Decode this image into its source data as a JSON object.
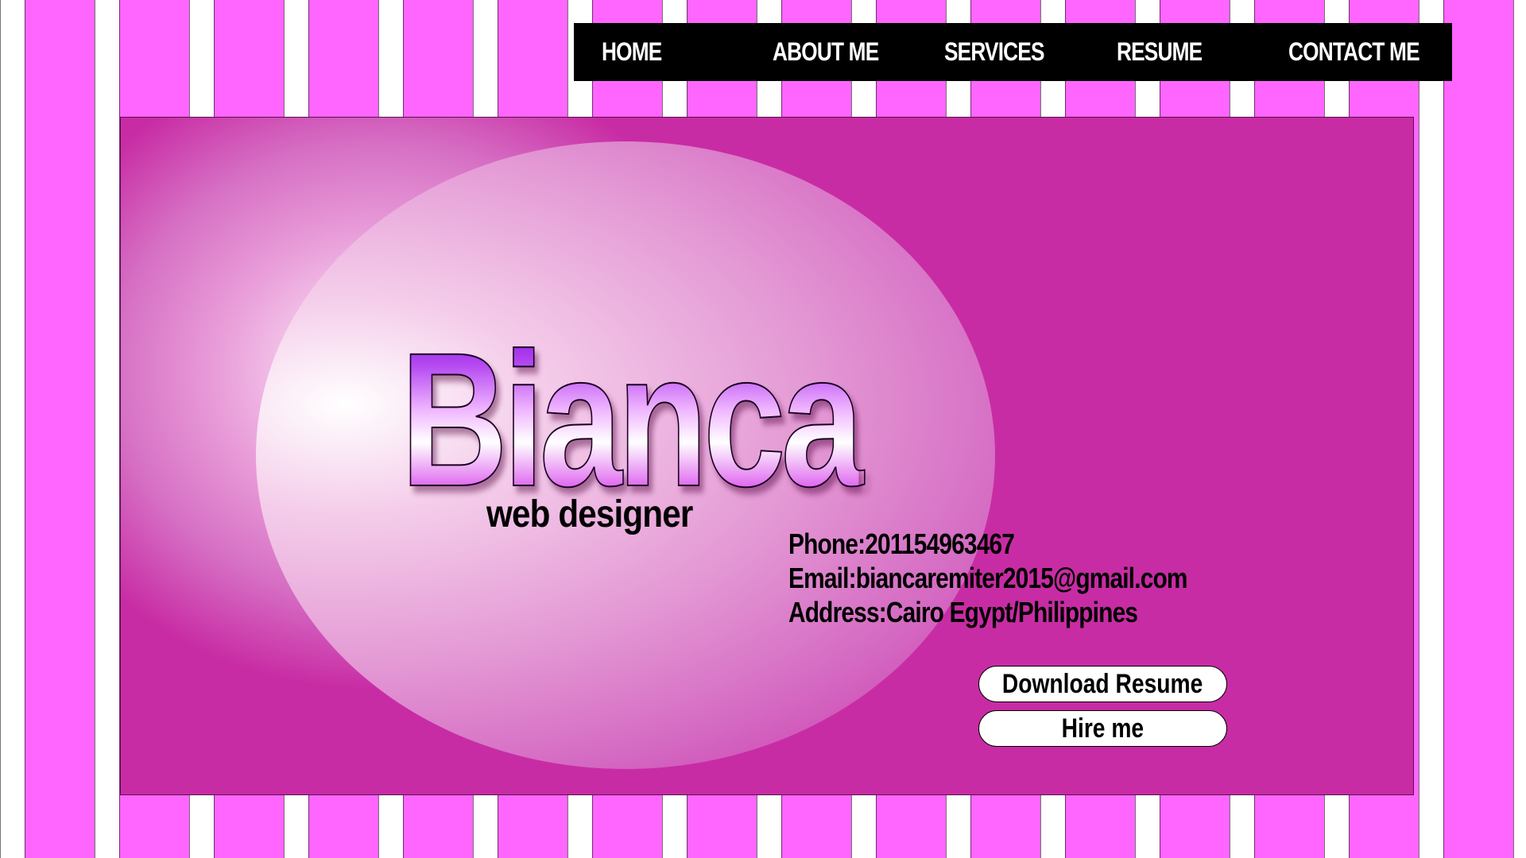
{
  "nav": {
    "items": [
      {
        "label": "HOME"
      },
      {
        "label": "ABOUT ME"
      },
      {
        "label": "SERVICES"
      },
      {
        "label": "RESUME"
      },
      {
        "label": "CONTACT ME"
      }
    ]
  },
  "hero": {
    "name": "Bianca",
    "role": "web designer"
  },
  "contact": {
    "phone": "Phone:201154963467",
    "email": "Email:biancaremiter2015@gmail.com",
    "address": "Address:Cairo Egypt/Philippines"
  },
  "actions": {
    "download_label": "Download Resume",
    "hire_label": "Hire me"
  },
  "colors": {
    "stripe_pink": "#ff66ff",
    "stripe_white": "#ffffff",
    "panel_magenta": "#c82ca4",
    "nav_bg": "#000000"
  }
}
